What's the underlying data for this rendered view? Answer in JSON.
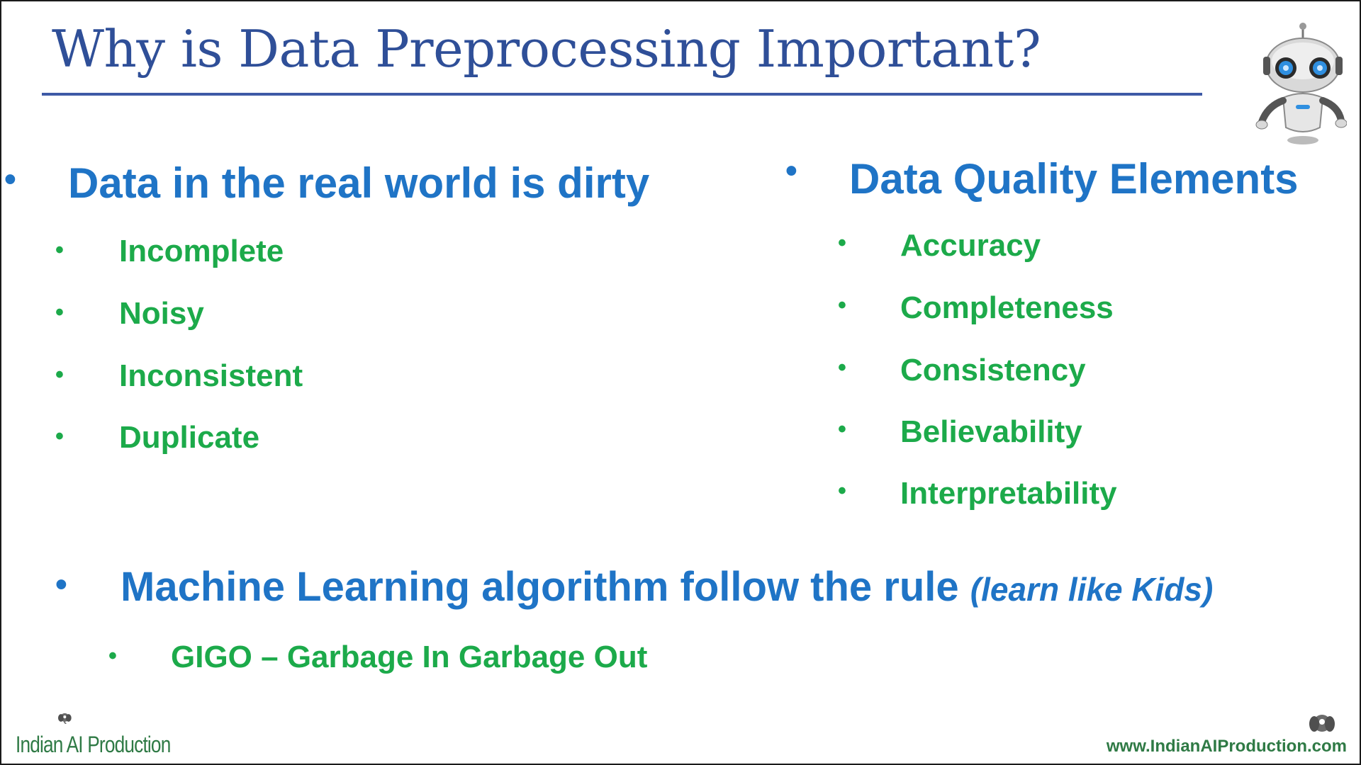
{
  "slide": {
    "title": "Why is Data Preprocessing Important?",
    "left_section": {
      "heading": "Data in the real world is dirty",
      "items": [
        "Incomplete",
        "Noisy",
        "Inconsistent",
        "Duplicate"
      ]
    },
    "right_section": {
      "heading": "Data Quality Elements",
      "items": [
        "Accuracy",
        "Completeness",
        "Consistency",
        "Believability",
        "Interpretability"
      ]
    },
    "bottom_section": {
      "heading": "Machine Learning algorithm follow the rule",
      "heading_note": "(learn like Kids)",
      "items": [
        "GIGO – Garbage In Garbage Out"
      ]
    },
    "bullet": "•",
    "footer": {
      "brand": "Indian AI Production",
      "url": "www.IndianAIProduction.com"
    }
  },
  "icons": [
    "robot-icon",
    "elephant-logo-icon"
  ],
  "colors": {
    "title": "#2f4f98",
    "heading": "#1f74c6",
    "item": "#1caa4a",
    "footer": "#2f7a45"
  }
}
